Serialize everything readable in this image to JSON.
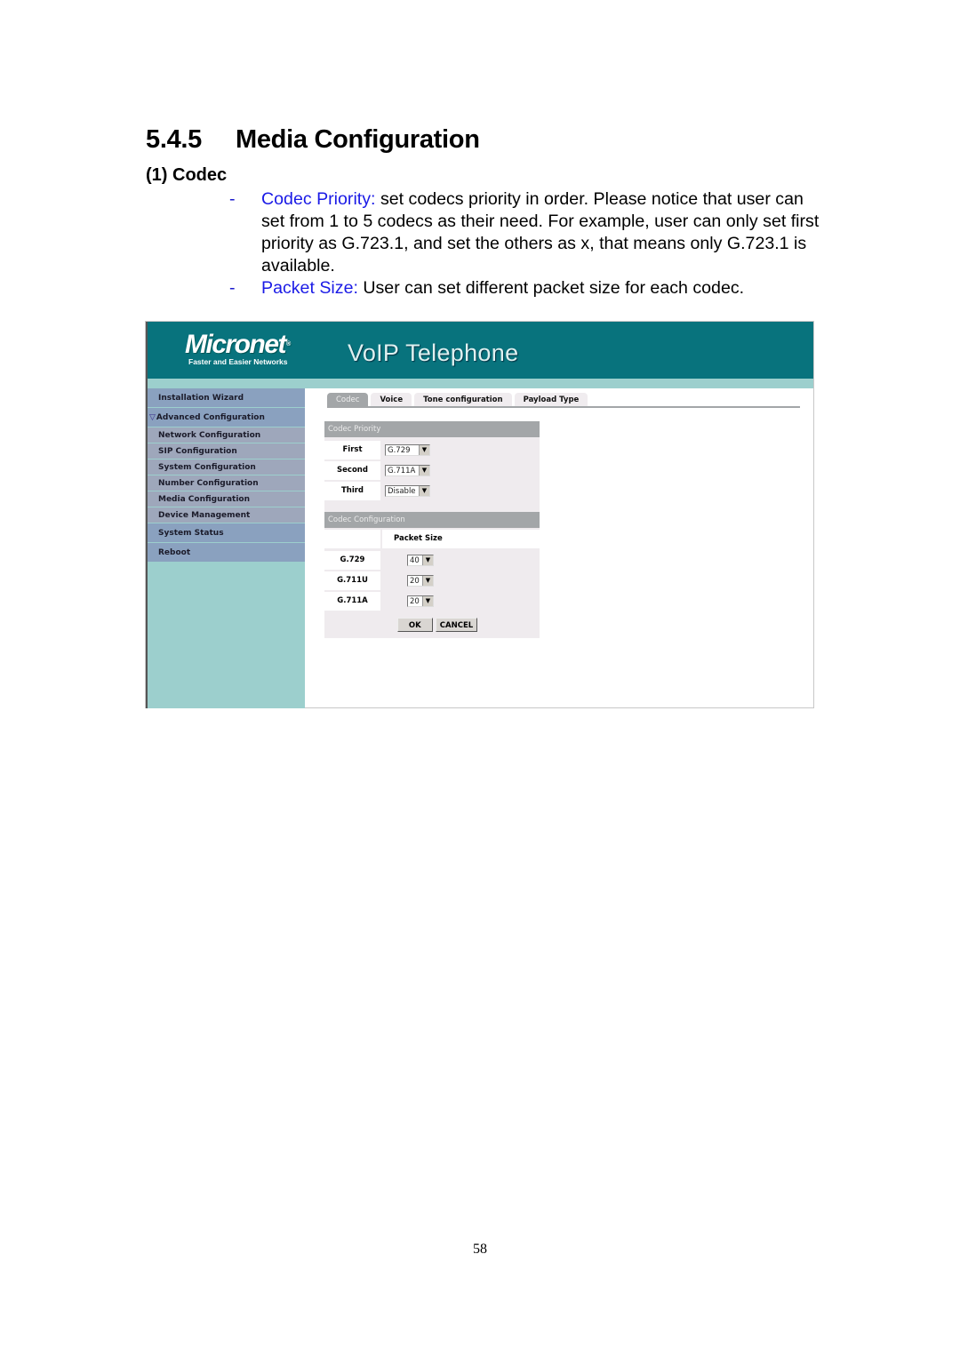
{
  "section": {
    "number": "5.4.5",
    "title": "Media Configuration",
    "subheading": "(1) Codec"
  },
  "bullets": [
    {
      "dash": "-",
      "term": "Codec Priority:",
      "text": " set codecs priority in order. Please notice that user can set from 1 to 5 codecs as their need. For example, user can only set first priority as G.723.1, and set the others as x, that means only G.723.1 is available."
    },
    {
      "dash": "-",
      "term": "Packet Size:",
      "text": " User can set different packet size for each codec."
    }
  ],
  "screenshot": {
    "brand": "Micronet",
    "brand_mark": "®",
    "tagline": "Faster and Easier Networks",
    "app_title": "VoIP Telephone",
    "colors": {
      "banner": "#08737d",
      "strip": "#9ccfcd",
      "nav": "#8aa1bf",
      "panel_header": "#a3a6a8"
    },
    "sidebar": {
      "items": [
        {
          "label": "Installation Wizard"
        },
        {
          "label": "Advanced Configuration",
          "icon": "triangle-down"
        },
        {
          "label": "Network Configuration"
        },
        {
          "label": "SIP Configuration"
        },
        {
          "label": "System Configuration"
        },
        {
          "label": "Number Configuration"
        },
        {
          "label": "Media Configuration"
        },
        {
          "label": "Device Management"
        },
        {
          "label": "System Status"
        },
        {
          "label": "Reboot"
        }
      ]
    },
    "tabs": [
      {
        "label": "Codec",
        "active": true
      },
      {
        "label": "Voice"
      },
      {
        "label": "Tone configuration"
      },
      {
        "label": "Payload Type"
      }
    ],
    "codec_priority": {
      "header": "Codec Priority",
      "rows": [
        {
          "label": "First",
          "value": "G.729"
        },
        {
          "label": "Second",
          "value": "G.711A"
        },
        {
          "label": "Third",
          "value": "Disable"
        }
      ]
    },
    "codec_configuration": {
      "header": "Codec Configuration",
      "column": "Packet Size",
      "rows": [
        {
          "codec": "G.729",
          "packet_size": "40"
        },
        {
          "codec": "G.711U",
          "packet_size": "20"
        },
        {
          "codec": "G.711A",
          "packet_size": "20"
        }
      ]
    },
    "buttons": {
      "ok": "OK",
      "cancel": "CANCEL"
    }
  },
  "page_number": "58"
}
